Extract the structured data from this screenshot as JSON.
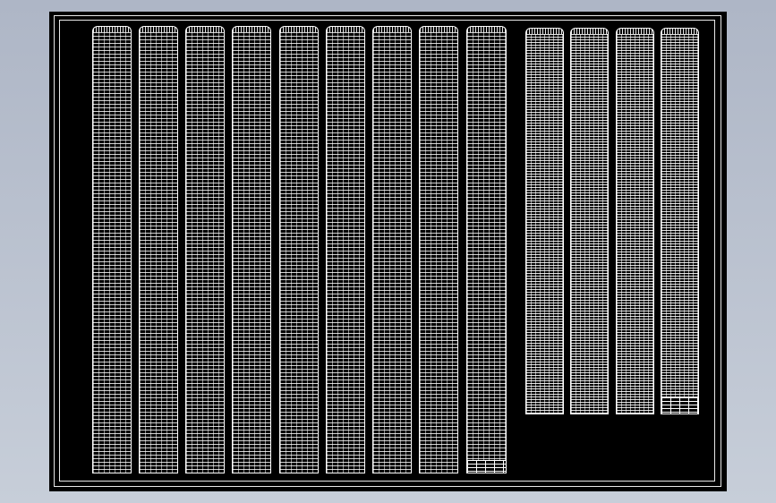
{
  "drawing": {
    "theme": {
      "window_background": "#b9c0cd",
      "sheet_background": "#000000",
      "line_color": "#ffffff",
      "legend_color": "#f2e600"
    },
    "left_group": {
      "table_count": 9
    },
    "right_group": {
      "table_count": 4
    },
    "legend": {
      "text": ""
    }
  }
}
